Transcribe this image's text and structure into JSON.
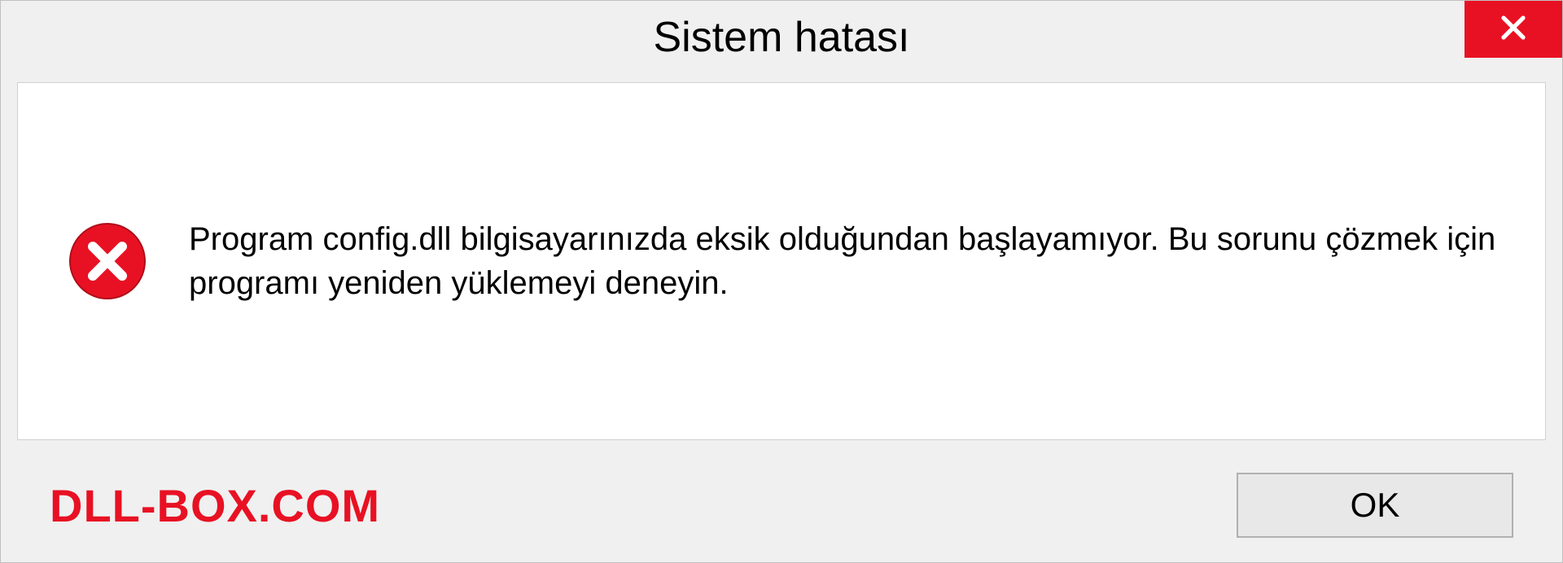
{
  "titlebar": {
    "title": "Sistem hatası"
  },
  "content": {
    "message": "Program config.dll bilgisayarınızda eksik olduğundan başlayamıyor. Bu sorunu çözmek için programı yeniden yüklemeyi deneyin."
  },
  "footer": {
    "watermark": "DLL-BOX.COM",
    "ok_label": "OK"
  }
}
